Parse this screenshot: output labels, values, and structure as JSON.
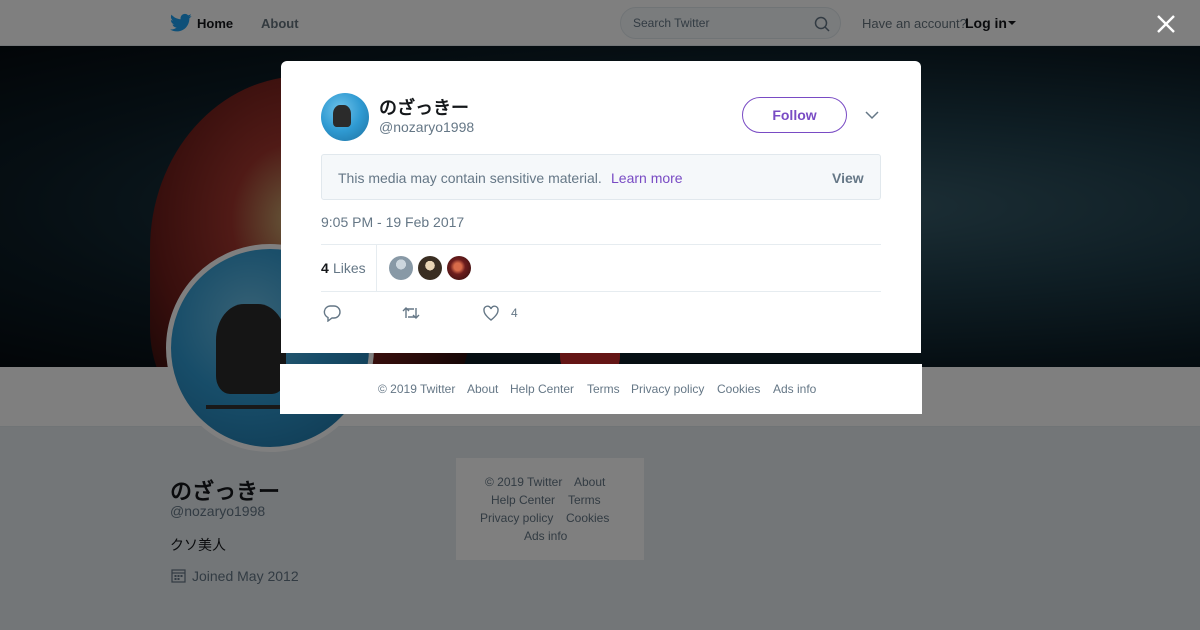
{
  "nav": {
    "home": "Home",
    "about": "About",
    "search_placeholder": "Search Twitter",
    "have_account": "Have an account?",
    "login": "Log in"
  },
  "profile": {
    "name": "のざっきー",
    "handle": "@nozaryo1998",
    "bio": "クソ美人",
    "joined": "Joined May 2012"
  },
  "side_footer": [
    "© 2019 Twitter",
    "About",
    "Help Center",
    "Terms",
    "Privacy policy",
    "Cookies",
    "Ads info"
  ],
  "tweet": {
    "name": "のざっきー",
    "handle": "@nozaryo1998",
    "follow": "Follow",
    "sensitive_text": "This media may contain sensitive material.",
    "learn_more": "Learn more",
    "view": "View",
    "time": "9:05 PM - 19 Feb 2017",
    "likes_count": "4",
    "likes_label": "Likes",
    "like_action_count": "4"
  },
  "modal_footer": [
    "© 2019 Twitter",
    "About",
    "Help Center",
    "Terms",
    "Privacy policy",
    "Cookies",
    "Ads info"
  ],
  "colors": {
    "accent": "#794bc4",
    "twitter_blue": "#1da1f2",
    "muted": "#657786"
  },
  "icons": [
    "twitter-bird-icon",
    "search-icon",
    "caret-down-icon",
    "close-icon",
    "chevron-down-icon",
    "reply-icon",
    "retweet-icon",
    "heart-icon",
    "calendar-icon"
  ]
}
